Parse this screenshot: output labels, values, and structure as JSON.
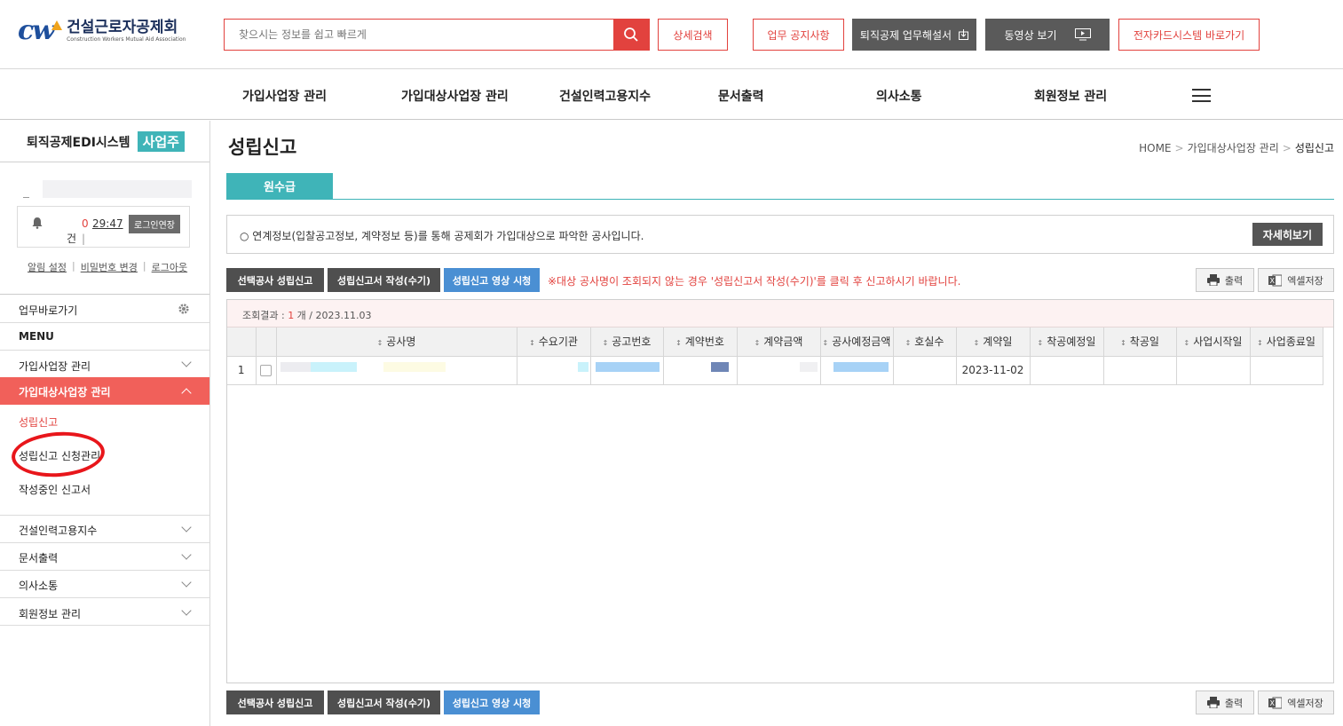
{
  "brand": {
    "mark": "cw",
    "name_kr": "건설근로자공제회",
    "name_en": "Construction Workers Mutual Aid Association"
  },
  "search": {
    "placeholder": "찾으시는 정보를 쉽고 빠르게"
  },
  "header_buttons": {
    "detail_search": "상세검색",
    "notice": "업무 공지사항",
    "manual": "퇴직공제 업무해설서",
    "video": "동영상 보기",
    "ecard": "전자카드시스템 바로가기"
  },
  "gnb": [
    "가입사업장 관리",
    "가입대상사업장 관리",
    "건설인력고용지수",
    "문서출력",
    "의사소통",
    "회원정보 관리"
  ],
  "sidebar": {
    "system_title": "퇴직공제EDI시스템",
    "role_badge": "사업주",
    "alert_count": "0",
    "unit": "건",
    "timer": "29:47",
    "extend_label": "로그인연장",
    "links": [
      "알림 설정",
      "비밀번호 변경",
      "로그아웃"
    ],
    "shortcut_label": "업무바로가기",
    "menu_heading": "MENU",
    "menu": [
      {
        "label": "가입사업장 관리"
      },
      {
        "label": "가입대상사업장 관리",
        "active": true
      },
      {
        "label": "건설인력고용지수"
      },
      {
        "label": "문서출력"
      },
      {
        "label": "의사소통"
      },
      {
        "label": "회원정보 관리"
      }
    ],
    "submenu": [
      "성립신고",
      "성립신고 신청관리",
      "작성중인 신고서"
    ]
  },
  "page": {
    "title": "성립신고",
    "breadcrumb": [
      "HOME",
      "가입대상사업장 관리",
      "성립신고"
    ],
    "tab": "원수급",
    "notice": "○ 연계정보(입찰공고정보, 계약정보 등)를 통해 공제회가 가입대상으로 파악한 공사입니다.",
    "detail_button": "자세히보기",
    "actions": {
      "report_selected": "선택공사 성립신고",
      "write_manual": "성립신고서 작성(수기)",
      "watch_video": "성립신고 영상 시청",
      "warning": "※대상 공사명이 조회되지 않는 경우 '성립신고서 작성(수기)'를 클릭 후 신고하시기 바랍니다.",
      "print": "출력",
      "excel": "엑셀저장"
    },
    "result": {
      "label": "조회결과 : ",
      "count": "1",
      "unit": " 개 / ",
      "date": "2023.11.03"
    },
    "table": {
      "columns": [
        "공사명",
        "수요기관",
        "공고번호",
        "계약번호",
        "계약금액",
        "공사예정금액",
        "호실수",
        "계약일",
        "착공예정일",
        "착공일",
        "사업시작일",
        "사업종료일"
      ],
      "rows": [
        {
          "no": "1",
          "contract_date": "2023-11-02"
        }
      ]
    }
  },
  "colors": {
    "accent_red": "#e2423e",
    "teal": "#3fb4b8",
    "active_menu": "#f1605a",
    "video_blue": "#4a8fd3"
  }
}
